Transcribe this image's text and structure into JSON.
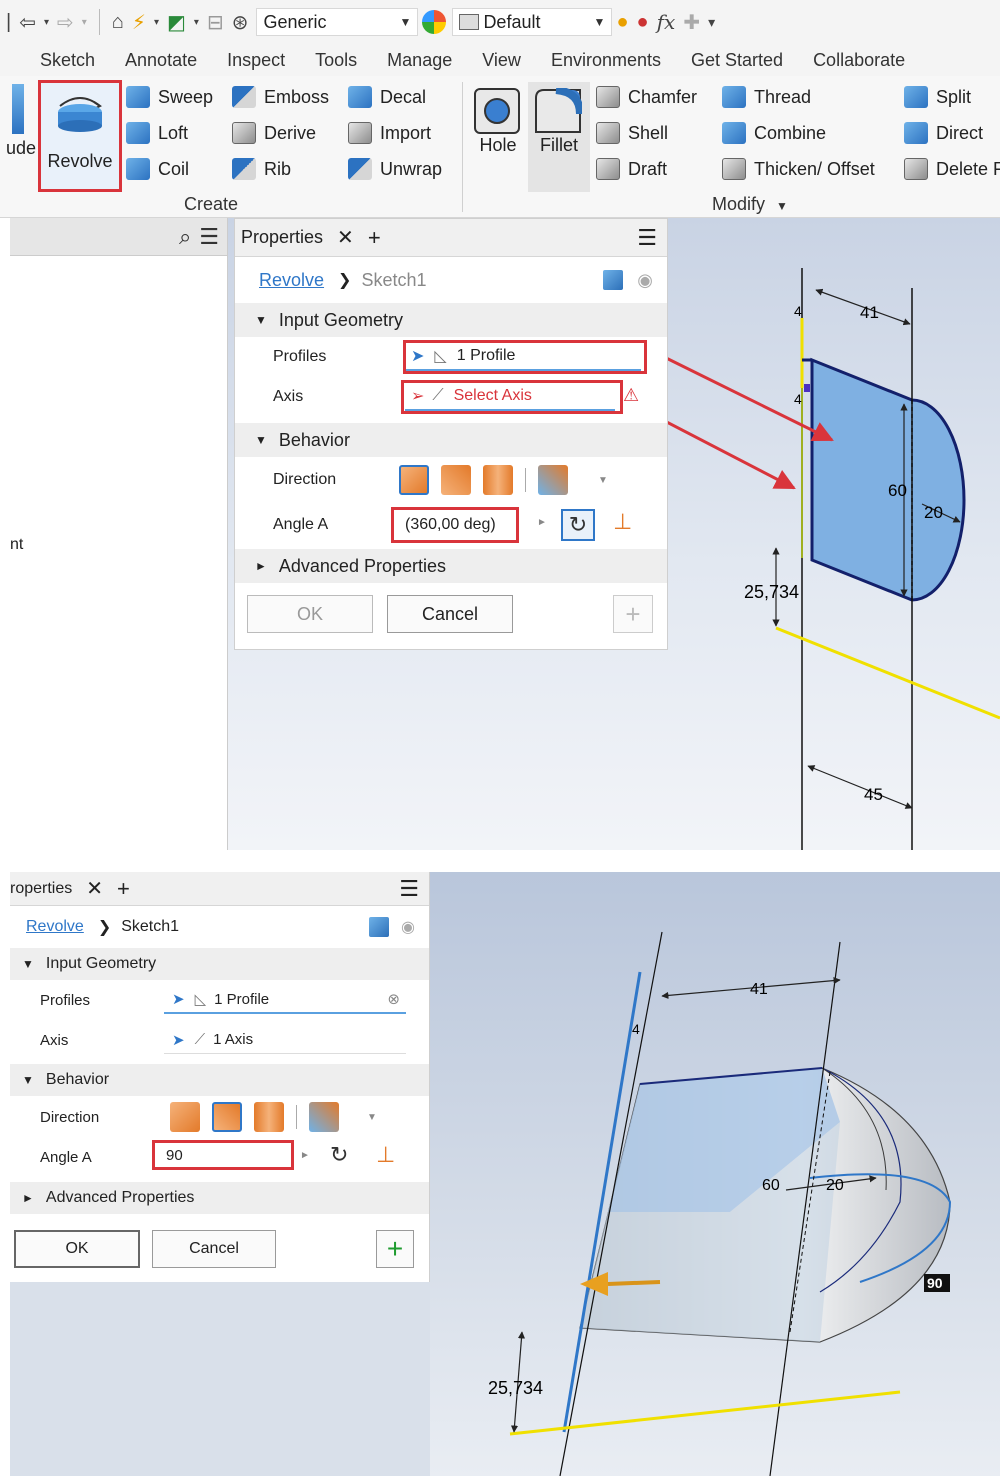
{
  "toolbar": {
    "visual_style": "Generic",
    "appearance": "Default",
    "fx": "fx"
  },
  "tabs": [
    "Sketch",
    "Annotate",
    "Inspect",
    "Tools",
    "Manage",
    "View",
    "Environments",
    "Get Started",
    "Collaborate"
  ],
  "ribbon": {
    "partial_left": "ude",
    "revolve": "Revolve",
    "create_items": [
      "Sweep",
      "Loft",
      "Coil",
      "Emboss",
      "Derive",
      "Rib",
      "Decal",
      "Import",
      "Unwrap"
    ],
    "create_label": "Create",
    "hole": "Hole",
    "fillet": "Fillet",
    "modify_items": [
      "Chamfer",
      "Shell",
      "Draft",
      "Thread",
      "Combine",
      "Thicken/ Offset",
      "Split",
      "Direct",
      "Delete F"
    ],
    "modify_label": "Modify"
  },
  "browser": {
    "fragment": "nt"
  },
  "props_top": {
    "tab": "Properties",
    "feature": "Revolve",
    "sketch": "Sketch1",
    "input_geometry": "Input Geometry",
    "profiles_label": "Profiles",
    "profiles_value": "1 Profile",
    "axis_label": "Axis",
    "axis_value": "Select Axis",
    "behavior": "Behavior",
    "direction_label": "Direction",
    "angle_label": "Angle A",
    "angle_value": "(360,00 deg)",
    "advanced": "Advanced Properties",
    "ok": "OK",
    "cancel": "Cancel"
  },
  "sketch_top": {
    "dim_41": "41",
    "dim_4a": "4",
    "dim_4b": "4",
    "dim_60": "60",
    "dim_20": "20",
    "dim_25": "25,734",
    "dim_45": "45"
  },
  "props_bottom": {
    "tab": "roperties",
    "feature": "Revolve",
    "sketch": "Sketch1",
    "input_geometry": "Input Geometry",
    "profiles_label": "Profiles",
    "profiles_value": "1 Profile",
    "axis_label": "Axis",
    "axis_value": "1 Axis",
    "behavior": "Behavior",
    "direction_label": "Direction",
    "angle_label": "Angle A",
    "angle_value": "90",
    "advanced": "Advanced Properties",
    "ok": "OK",
    "cancel": "Cancel"
  },
  "sketch_bottom": {
    "dim_41": "41",
    "dim_4": "4",
    "dim_60": "60",
    "dim_20": "20",
    "dim_25": "25,734",
    "angle_tag": "90"
  },
  "colors": {
    "accent_blue": "#2f77c8",
    "highlight_red": "#d9343b",
    "profile_fill": "#7fb0e2",
    "axis_yellow": "#f0e000"
  }
}
